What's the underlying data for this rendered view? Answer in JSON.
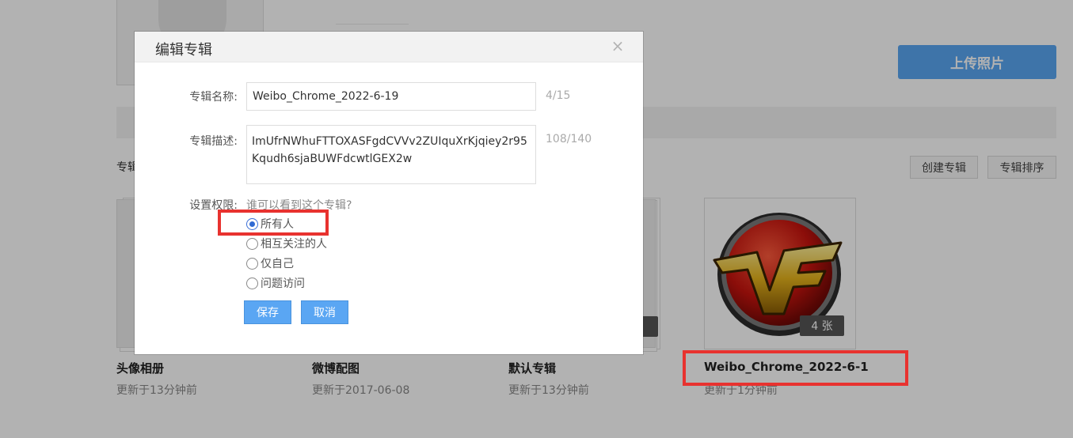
{
  "page": {
    "upload_button": "上传照片",
    "section_label": "专辑",
    "create_album_button": "创建专辑",
    "sort_album_button": "专辑排序"
  },
  "albums": [
    {
      "name": "头像相册",
      "date": "更新于13分钟前"
    },
    {
      "name": "微博配图",
      "date": "更新于2017-06-08"
    },
    {
      "name": "默认专辑",
      "date": "更新于13分钟前"
    },
    {
      "name": "Weibo_Chrome_2022-6-1",
      "date": "更新于1分钟前",
      "count": "4 张"
    }
  ],
  "dialog": {
    "title": "编辑专辑",
    "close_glyph": "×",
    "name_label": "专辑名称:",
    "name_value": "Weibo_Chrome_2022-6-19",
    "name_counter": "4/15",
    "desc_label": "专辑描述:",
    "desc_value": "ImUfrNWhuFTTOXASFgdCVVv2ZUIquXrKjqiey2r95Kqudh6sjaBUWFdcwtlGEX2w",
    "desc_counter": "108/140",
    "perm_label": "设置权限:",
    "perm_hint": "谁可以看到这个专辑?",
    "perm_options": [
      {
        "label": "所有人",
        "checked": true
      },
      {
        "label": "相互关注的人",
        "checked": false
      },
      {
        "label": "仅自己",
        "checked": false
      },
      {
        "label": "问题访问",
        "checked": false
      }
    ],
    "save_button": "保存",
    "cancel_button": "取消"
  },
  "colors": {
    "primary_button": "#5aa6f3",
    "highlight_box": "#e8322f",
    "radio_selected": "#2f6ad3"
  }
}
